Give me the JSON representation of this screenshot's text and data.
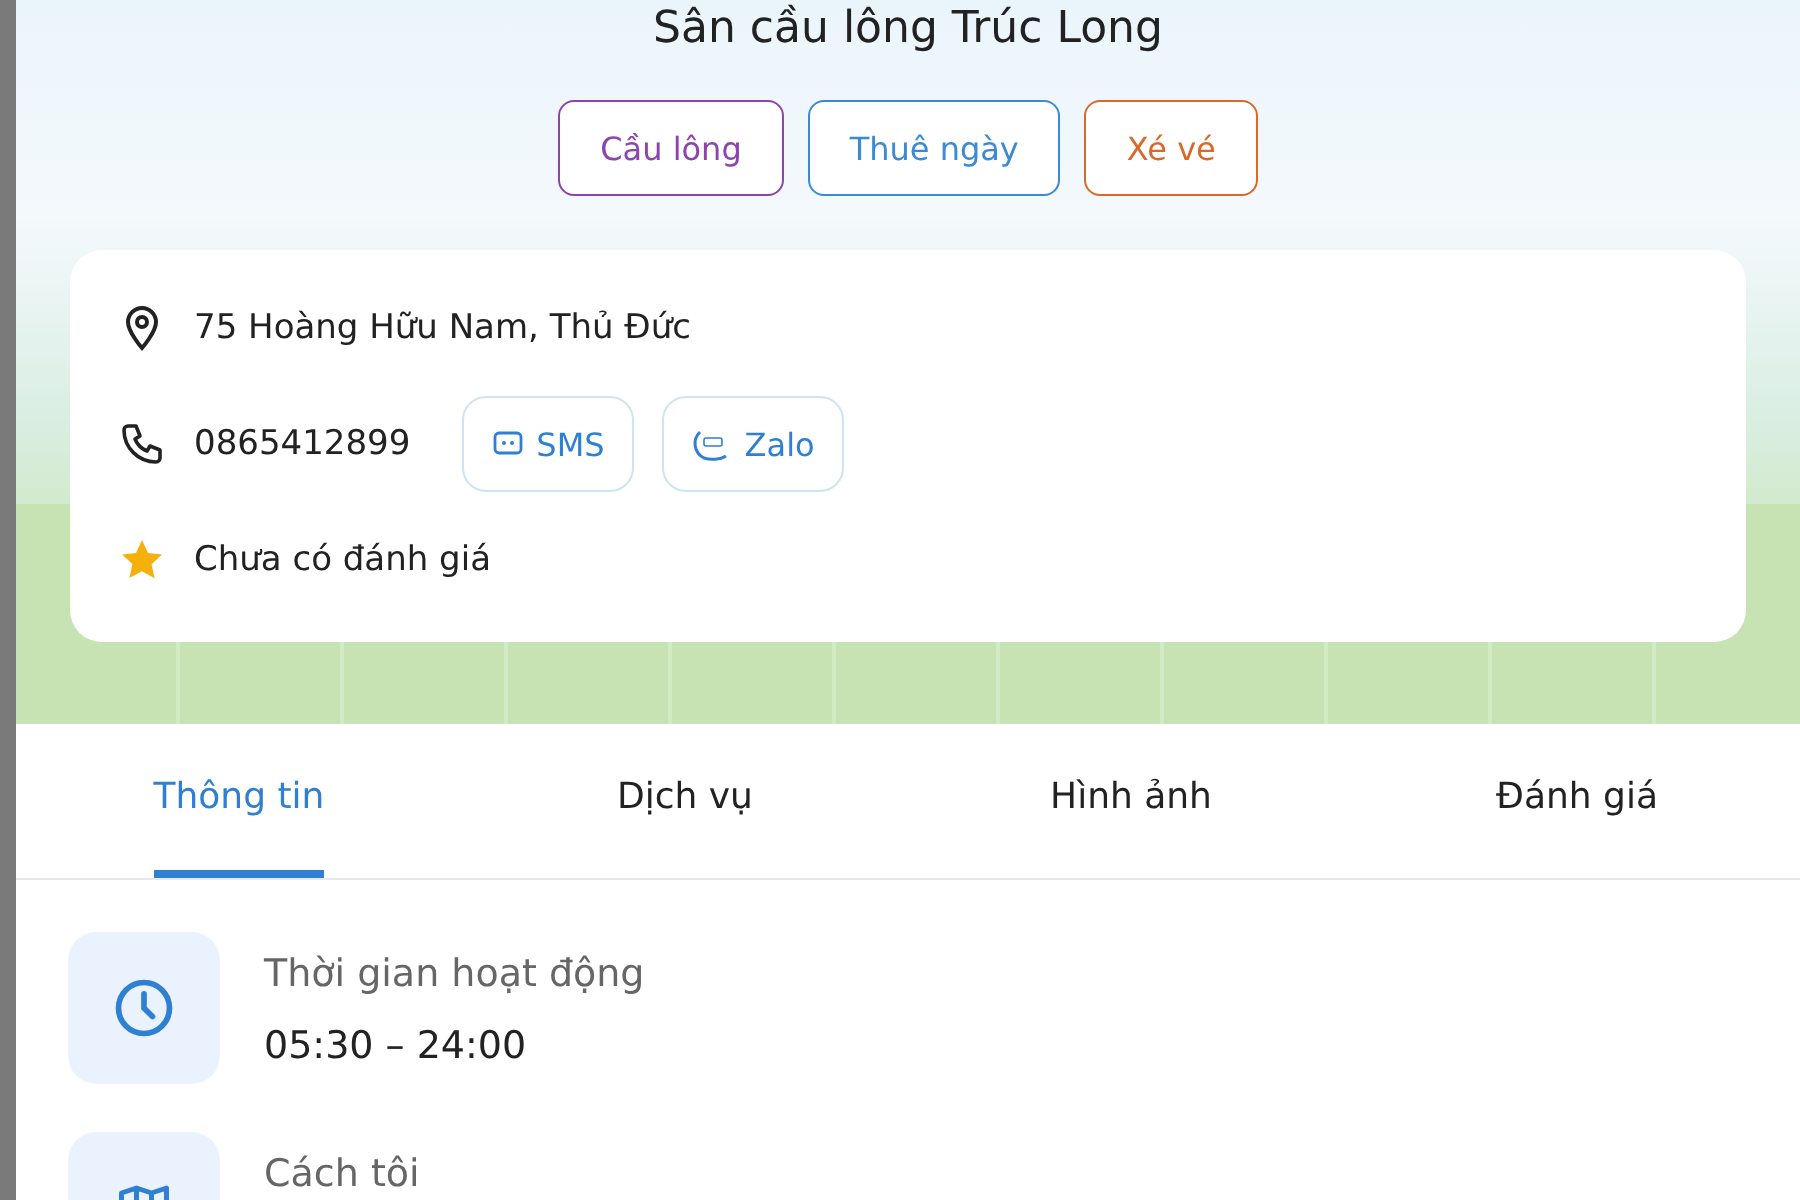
{
  "title": "Sân cầu lông Trúc Long",
  "tags": [
    {
      "label": "Cầu lông",
      "color": "#8e44ad"
    },
    {
      "label": "Thuê ngày",
      "color": "#3a8ad6"
    },
    {
      "label": "Xé vé",
      "color": "#d9692a"
    }
  ],
  "address": "75 Hoàng Hữu Nam, Thủ Đức",
  "phone": "0865412899",
  "contacts": [
    {
      "label": "SMS",
      "kind": "sms"
    },
    {
      "label": "Zalo",
      "kind": "zalo"
    }
  ],
  "rating": "Chưa có đánh giá",
  "tabs": [
    {
      "label": "Thông tin",
      "selected": true
    },
    {
      "label": "Dịch vụ",
      "selected": false
    },
    {
      "label": "Hình ảnh",
      "selected": false
    },
    {
      "label": "Đánh giá",
      "selected": false
    }
  ],
  "info": [
    {
      "kind": "clock",
      "label": "Thời gian hoạt động",
      "value": "05:30 – 24:00"
    },
    {
      "kind": "map",
      "label": "Cách tôi"
    }
  ]
}
